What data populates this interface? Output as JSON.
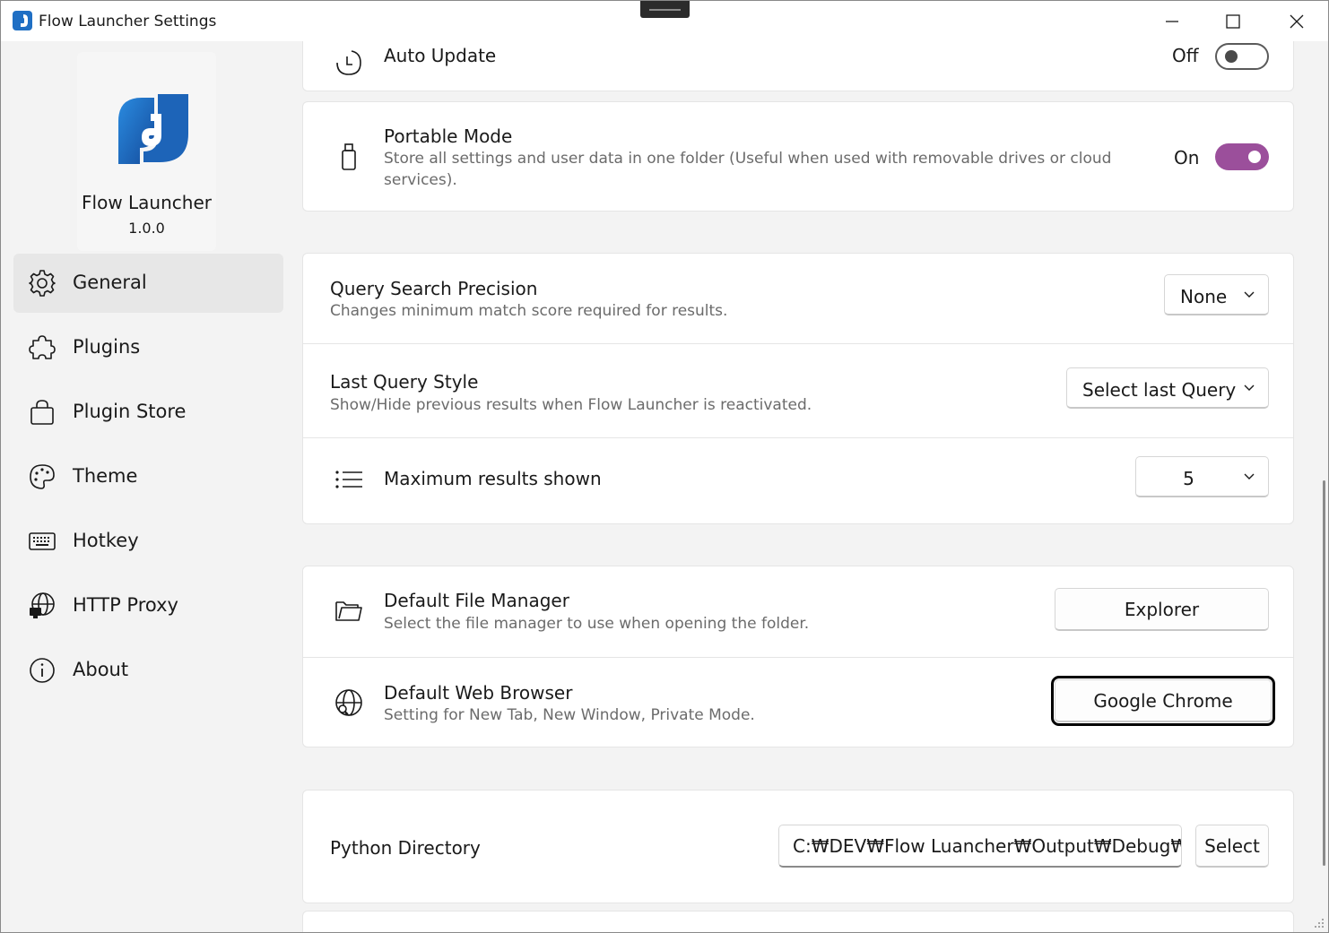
{
  "window": {
    "title": "Flow Launcher Settings",
    "controls": {
      "minimize": "minimize-icon",
      "maximize": "maximize-icon",
      "close": "close-icon"
    }
  },
  "sidebar": {
    "app_name": "Flow Launcher",
    "version": "1.0.0",
    "items": [
      {
        "label": "General",
        "icon": "gear-icon",
        "active": true
      },
      {
        "label": "Plugins",
        "icon": "puzzle-icon",
        "active": false
      },
      {
        "label": "Plugin Store",
        "icon": "shopping-bag-icon",
        "active": false
      },
      {
        "label": "Theme",
        "icon": "palette-icon",
        "active": false
      },
      {
        "label": "Hotkey",
        "icon": "keyboard-icon",
        "active": false
      },
      {
        "label": "HTTP Proxy",
        "icon": "globe-proxy-icon",
        "active": false
      },
      {
        "label": "About",
        "icon": "info-icon",
        "active": false
      }
    ]
  },
  "settings": {
    "auto_update": {
      "title": "Auto Update",
      "state_label": "Off",
      "enabled": false
    },
    "portable_mode": {
      "title": "Portable Mode",
      "description": "Store all settings and user data in one folder (Useful when used with removable drives or cloud services).",
      "state_label": "On",
      "enabled": true
    },
    "query_search_precision": {
      "title": "Query Search Precision",
      "description": "Changes minimum match score required for results.",
      "value": "None"
    },
    "last_query_style": {
      "title": "Last Query Style",
      "description": "Show/Hide previous results when Flow Launcher is reactivated.",
      "value": "Select last Query"
    },
    "max_results": {
      "title": "Maximum results shown",
      "value": "5"
    },
    "default_file_manager": {
      "title": "Default File Manager",
      "description": "Select the file manager to use when opening the folder.",
      "button_label": "Explorer"
    },
    "default_web_browser": {
      "title": "Default Web Browser",
      "description": "Setting for New Tab, New Window, Private Mode.",
      "button_label": "Google Chrome"
    },
    "python_directory": {
      "title": "Python Directory",
      "path_value": "C:₩DEV₩Flow Luancher₩Output₩Debug₩UserData₩Settings",
      "select_label": "Select"
    }
  },
  "colors": {
    "accent_toggle": "#9b4f9b",
    "logo_blue": "#1f6fc4",
    "window_bg": "#f3f3f3"
  }
}
